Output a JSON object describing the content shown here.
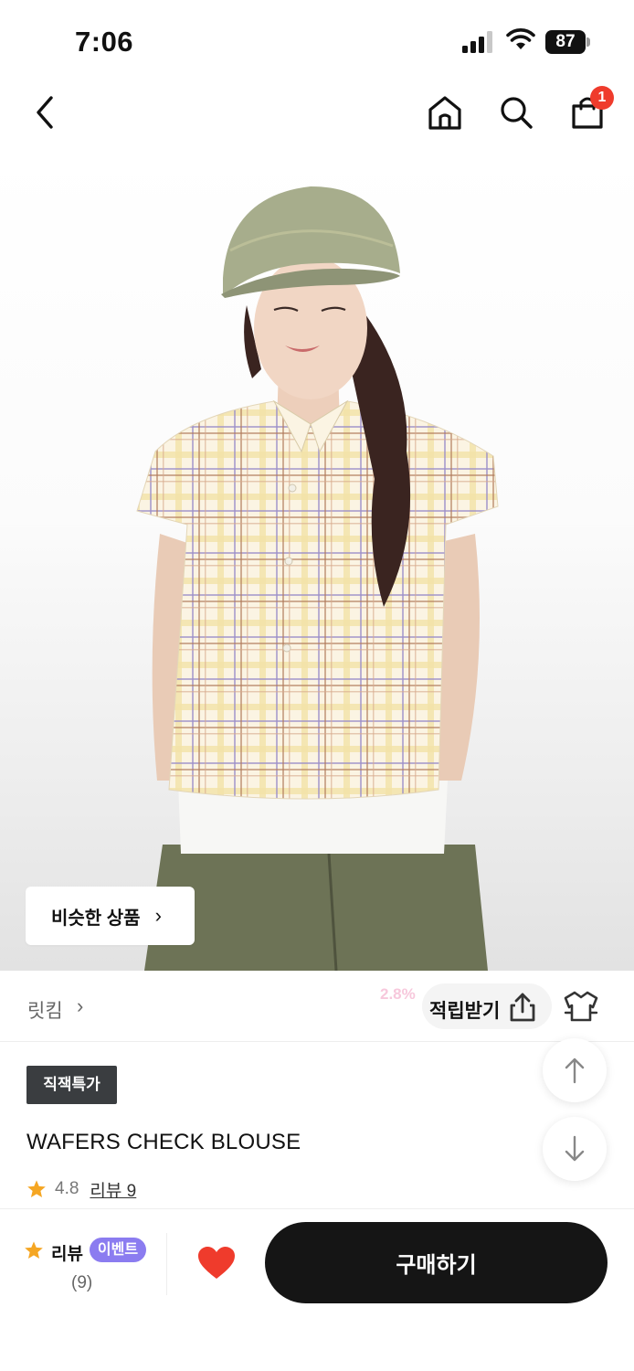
{
  "status_bar": {
    "time": "7:06",
    "battery": "87"
  },
  "nav": {
    "cart_count": "1",
    "icons": [
      "chevron-left-icon",
      "home-icon",
      "search-icon",
      "shopping-bag-icon"
    ]
  },
  "product_image": {
    "similar_products_label": "비슷한 상품"
  },
  "brand": {
    "name": "릿킴",
    "points_rate": "2.8%",
    "points_label": "적립받기"
  },
  "product": {
    "deal_badge": "직잭특가",
    "title": "WAFERS CHECK BLOUSE",
    "rating": "4.8",
    "review_link": "리뷰 9"
  },
  "bottom_bar": {
    "review_label": "리뷰",
    "event_badge": "이벤트",
    "review_count": "(9)",
    "buy_label": "구매하기"
  },
  "colors": {
    "accent_black": "#151515",
    "badge_red": "#ef3b2c",
    "event_purple": "#8b7cf0",
    "star_orange": "#f5a623",
    "heart_red": "#ef3b2c"
  }
}
